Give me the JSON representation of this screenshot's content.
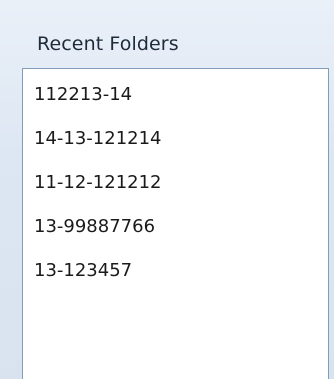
{
  "recent_folders": {
    "title": "Recent Folders",
    "items": [
      "112213-14",
      "14-13-121214",
      "11-12-121212",
      "13-99887766",
      "13-123457"
    ]
  }
}
